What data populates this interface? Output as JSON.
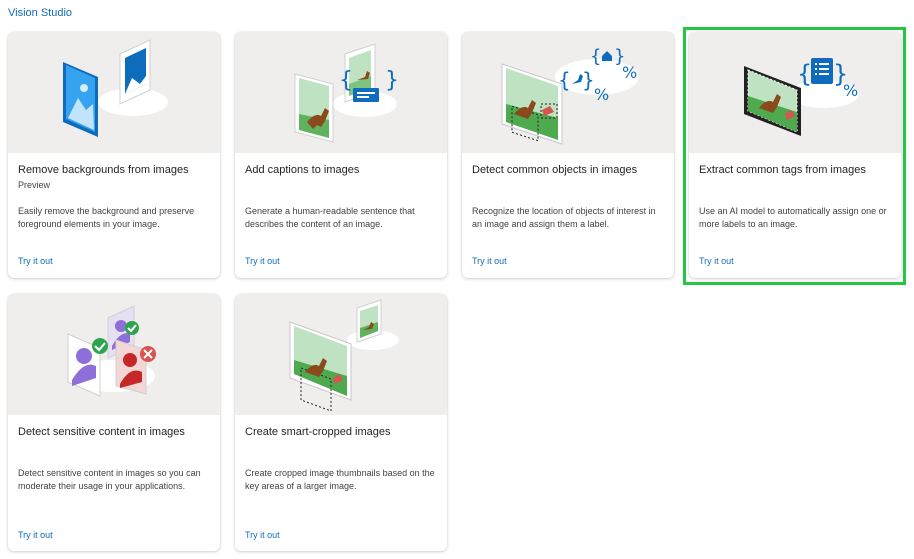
{
  "breadcrumb": "Vision Studio",
  "cards": [
    {
      "title": "Remove backgrounds from images",
      "badge": "Preview",
      "description": "Easily remove the background and preserve foreground elements in your image.",
      "cta": "Try it out",
      "icon": "remove-background-illustration"
    },
    {
      "title": "Add captions to images",
      "description": "Generate a human-readable sentence that describes the content of an image.",
      "cta": "Try it out",
      "icon": "caption-illustration"
    },
    {
      "title": "Detect common objects in images",
      "description": "Recognize the location of objects of interest in an image and assign them a label.",
      "cta": "Try it out",
      "icon": "object-detection-illustration"
    },
    {
      "title": "Extract common tags from images",
      "description": "Use an AI model to automatically assign one or more labels to an image.",
      "cta": "Try it out",
      "icon": "tagging-illustration"
    },
    {
      "title": "Detect sensitive content in images",
      "description": "Detect sensitive content in images so you can moderate their usage in your applications.",
      "cta": "Try it out",
      "icon": "content-moderation-illustration"
    },
    {
      "title": "Create smart-cropped images",
      "description": "Create cropped image thumbnails based on the key areas of a larger image.",
      "cta": "Try it out",
      "icon": "smart-crop-illustration"
    }
  ],
  "highlight_color": "#22c744",
  "accent_color": "#0f6cbd"
}
